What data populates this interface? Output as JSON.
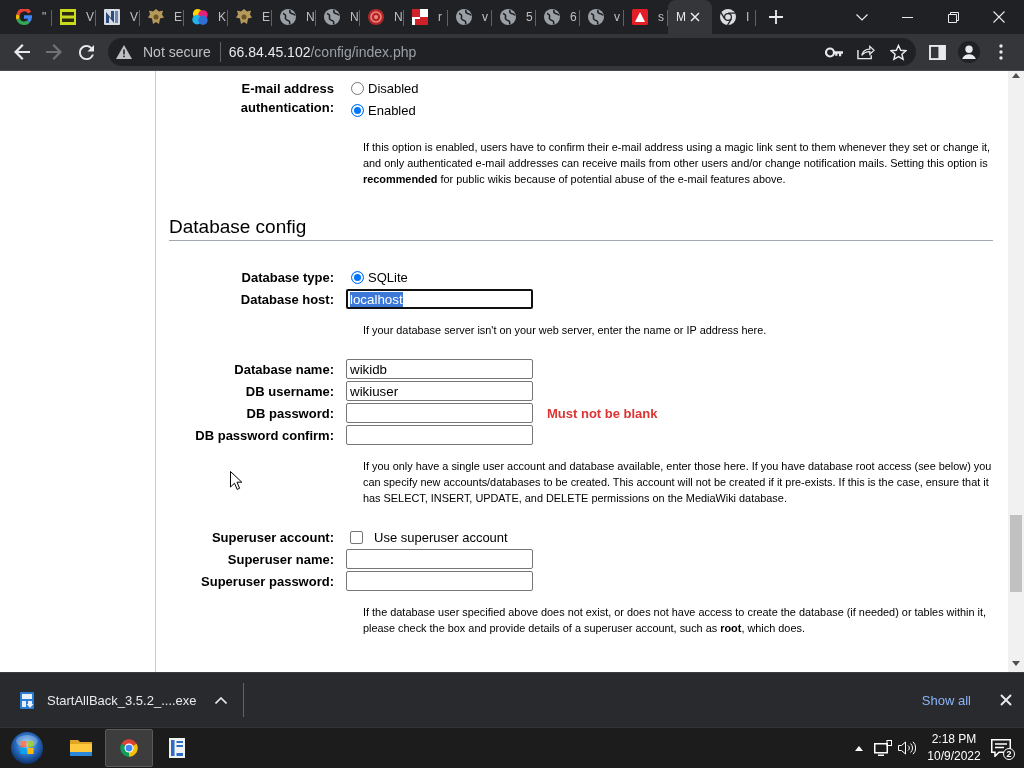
{
  "browser": {
    "tabs": [
      {
        "kind": "google",
        "title": "\"",
        "selected": false
      },
      {
        "kind": "vhs",
        "title": "V",
        "selected": false
      },
      {
        "kind": "nlogo",
        "title": "V",
        "selected": false
      },
      {
        "kind": "crest",
        "title": "E",
        "selected": false
      },
      {
        "kind": "colors",
        "title": "K",
        "selected": false
      },
      {
        "kind": "crest",
        "title": "E",
        "selected": false
      },
      {
        "kind": "globe",
        "title": "N",
        "selected": false
      },
      {
        "kind": "globe",
        "title": "N",
        "selected": false
      },
      {
        "kind": "redcircle",
        "title": "N",
        "selected": false
      },
      {
        "kind": "checker",
        "title": "r",
        "selected": false
      },
      {
        "kind": "globe",
        "title": "v",
        "selected": false
      },
      {
        "kind": "globe",
        "title": "5",
        "selected": false
      },
      {
        "kind": "globe",
        "title": "6",
        "selected": false
      },
      {
        "kind": "globe",
        "title": "v",
        "selected": false
      },
      {
        "kind": "triangle",
        "title": "s",
        "selected": false
      },
      {
        "title": "M",
        "selected": true
      },
      {
        "kind": "chrome",
        "title": "I",
        "selected": false
      }
    ],
    "nav": [
      {
        "kind": "back",
        "disabled": false
      },
      {
        "kind": "forward",
        "disabled": true
      },
      {
        "kind": "reload",
        "disabled": false
      }
    ],
    "address": {
      "security": "Not secure",
      "host": "66.84.45.102",
      "path": "/config/index.php"
    }
  },
  "page": {
    "items": [
      {
        "kind": "radio_group",
        "label": "E-mail address authentication:",
        "options": [
          {
            "label": "Disabled",
            "selected": false
          },
          {
            "label": "Enabled",
            "selected": true
          }
        ]
      },
      {
        "kind": "help",
        "text": "If this option is enabled, users have to confirm their e-mail address using a magic link sent to them whenever they set or change it, and only authenticated e-mail addresses can receive mails from other users and/or change notification mails. Setting this option is **recommended** for public wikis because of potential abuse of the e-mail features above."
      },
      {
        "kind": "heading",
        "text": "Database config"
      },
      {
        "kind": "radio_group",
        "label": "Database type:",
        "options": [
          {
            "label": "SQLite",
            "selected": true
          }
        ]
      },
      {
        "kind": "text_field",
        "label": "Database host:",
        "value": "localhost",
        "focused": true
      },
      {
        "kind": "help",
        "text": "If your database server isn't on your web server, enter the name or IP address here."
      },
      {
        "kind": "text_field",
        "label": "Database name:",
        "value": "wikidb",
        "focused": false
      },
      {
        "kind": "text_field",
        "label": "DB username:",
        "value": "wikiuser",
        "focused": false
      },
      {
        "kind": "text_field",
        "label": "DB password:",
        "focused": false,
        "error": "Must not be blank"
      },
      {
        "kind": "text_field",
        "label": "DB password confirm:",
        "focused": false
      },
      {
        "kind": "help",
        "text": "If you only have a single user account and database available, enter those here. If you have database root access (see below) you can specify new accounts/databases to be created. This account will not be created if it pre-exists. If this is the case, ensure that it has SELECT, INSERT, UPDATE, and DELETE permissions on the MediaWiki database."
      },
      {
        "kind": "checkbox",
        "label": "Superuser account:",
        "option": "Use superuser account",
        "checked": false
      },
      {
        "kind": "text_field",
        "label": "Superuser name:",
        "focused": false
      },
      {
        "kind": "text_field",
        "label": "Superuser password:",
        "focused": false
      },
      {
        "kind": "help",
        "text": "If the database user specified above does not exist, or does not have access to create the database (if needed) or tables within it, please check the box and provide details of a superuser account, such as **root**, which does."
      }
    ]
  },
  "download_bar": {
    "file": "StartAllBack_3.5.2_....exe",
    "show_all": "Show all"
  },
  "taskbar": {
    "apps": [
      {
        "kind": "explorer",
        "active": false
      },
      {
        "kind": "chrome",
        "active": true
      },
      {
        "kind": "panel",
        "active": false
      }
    ],
    "time": "2:18 PM",
    "date": "10/9/2022",
    "notification_count": "2"
  }
}
